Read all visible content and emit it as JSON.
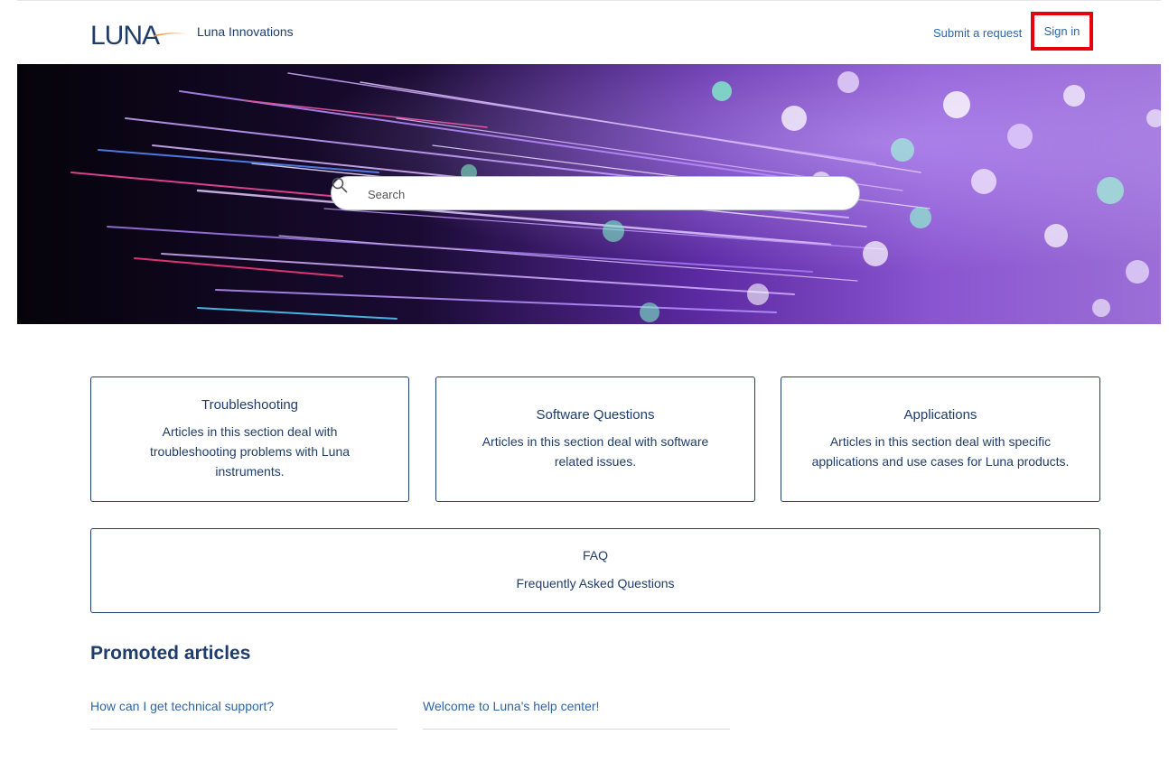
{
  "header": {
    "site_name": "Luna Innovations",
    "submit_request": "Submit a request",
    "sign_in": "Sign in"
  },
  "brand": {
    "logo_text": "LUNA",
    "color": "#1f3d6b",
    "accent_orange": "#f08a24",
    "highlight_red": "#e8000b"
  },
  "search": {
    "placeholder": "Search"
  },
  "categories": [
    {
      "title": "Troubleshooting",
      "description": "Articles in this section deal with troubleshooting problems with Luna instruments."
    },
    {
      "title": "Software Questions",
      "description": "Articles in this section deal with software related issues."
    },
    {
      "title": "Applications",
      "description": "Articles in this section deal with specific applications and use cases for Luna products."
    },
    {
      "title": "FAQ",
      "description": "Frequently Asked Questions"
    }
  ],
  "promoted": {
    "heading": "Promoted articles",
    "articles": [
      "How can I get technical support?",
      "Welcome to Luna's help center!"
    ]
  },
  "icons": {
    "search": "search-icon",
    "logo": "luna-logo"
  }
}
